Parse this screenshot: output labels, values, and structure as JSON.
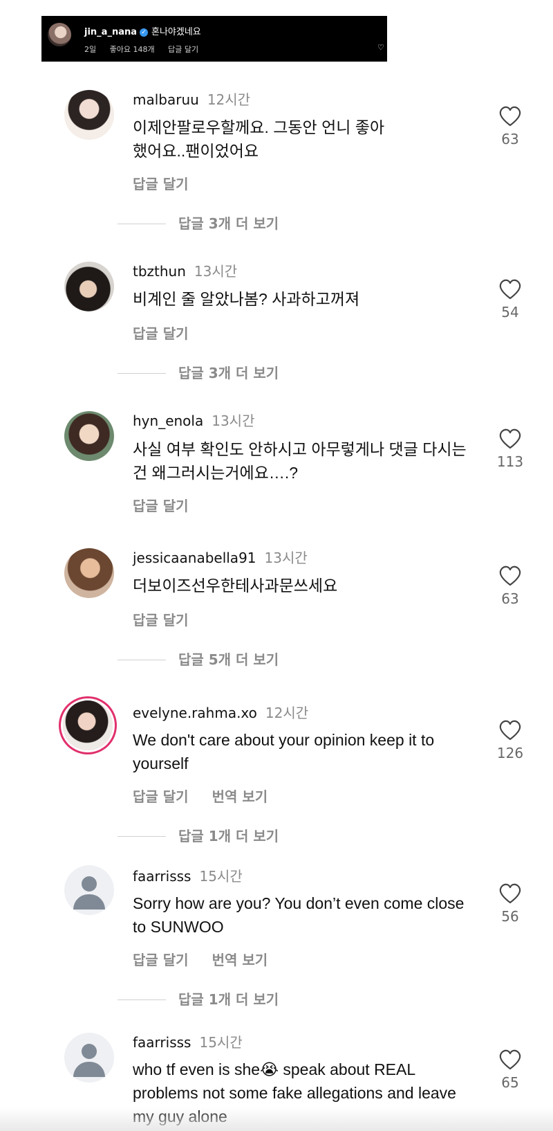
{
  "header": {
    "username": "jin_a_nana",
    "verified_icon": "verified-badge-icon",
    "caption": "혼나야겠네요",
    "age": "2일",
    "likes": "좋아요 148개",
    "reply_label": "답글 달기",
    "heart_icon": "heart-outline-icon"
  },
  "comments": [
    {
      "username": "malbaruu",
      "time": "12시간",
      "text": "이제안팔로우할께요. 그동안 언니 좋아했어요..팬이었어요",
      "reply_label": "답글 달기",
      "likes": "63",
      "view_replies": "답글 3개 더 보기"
    },
    {
      "username": "tbzthun",
      "time": "13시간",
      "text": "비계인 줄 알았나봄? 사과하고꺼져",
      "reply_label": "답글 달기",
      "likes": "54",
      "view_replies": "답글 3개 더 보기"
    },
    {
      "username": "hyn_enola",
      "time": "13시간",
      "text": "사실 여부 확인도 안하시고 아무렇게나 댓글 다시는 건 왜그러시는거에요….?",
      "reply_label": "답글 달기",
      "likes": "113"
    },
    {
      "username": "jessicaanabella91",
      "time": "13시간",
      "text": "더보이즈선우한테사과문쓰세요",
      "reply_label": "답글 달기",
      "likes": "63",
      "view_replies": "답글 5개 더 보기"
    },
    {
      "username": "evelyne.rahma.xo",
      "time": "12시간",
      "text": "We don't care about your opinion keep it to yourself",
      "reply_label": "답글 달기",
      "translate_label": "번역 보기",
      "likes": "126",
      "view_replies": "답글 1개 더 보기"
    },
    {
      "username": "faarrisss",
      "time": "15시간",
      "text": "Sorry how are you? You don’t even come close to SUNWOO",
      "reply_label": "답글 달기",
      "translate_label": "번역 보기",
      "likes": "56",
      "view_replies": "답글 1개 더 보기"
    },
    {
      "username": "faarrisss",
      "time": "15시간",
      "text": "who tf even is she😭 speak about REAL problems not some fake allegations and leave my guy alone",
      "likes": "65"
    }
  ]
}
